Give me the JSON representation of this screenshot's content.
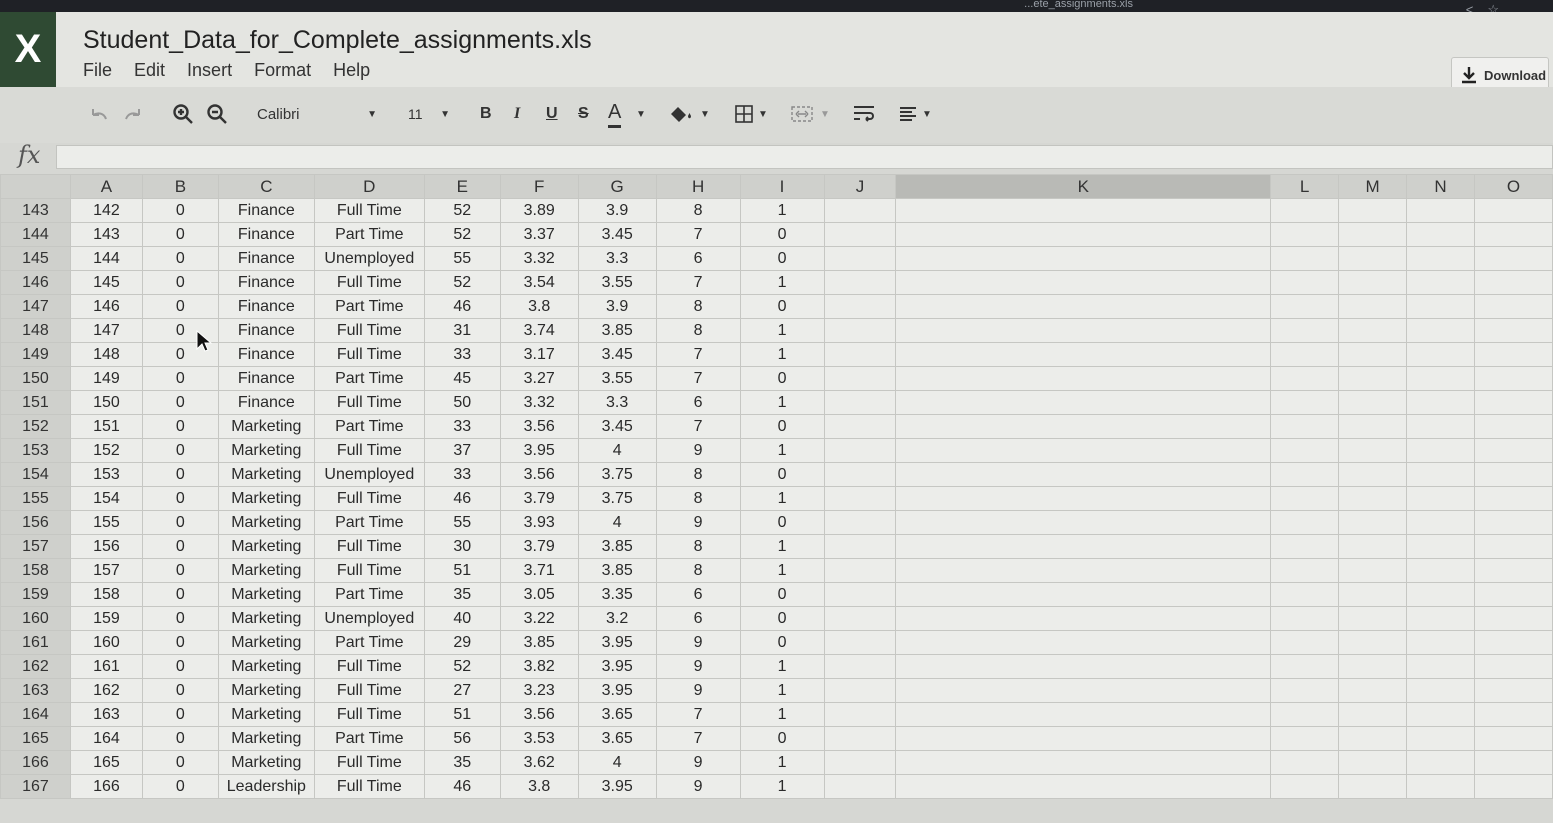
{
  "browser": {
    "url_text": "...ete_assignments.xls",
    "share_icon": "share-icon",
    "star_icon": "star-icon"
  },
  "app": {
    "logo": "X"
  },
  "document": {
    "title": "Student_Data_for_Complete_assignments.xls"
  },
  "menu": [
    "File",
    "Edit",
    "Insert",
    "Format",
    "Help"
  ],
  "download": {
    "label": "Download"
  },
  "toolbar": {
    "font": "Calibri",
    "font_size": "11",
    "bold": "B",
    "italic": "I",
    "underline": "U",
    "strike": "S",
    "text_color": "A"
  },
  "formula": {
    "label": "fx",
    "value": ""
  },
  "columns": [
    "A",
    "B",
    "C",
    "D",
    "E",
    "F",
    "G",
    "H",
    "I",
    "J",
    "K",
    "L",
    "M",
    "N",
    "O"
  ],
  "rows": [
    [
      "143",
      "142",
      "0",
      "Finance",
      "Full Time",
      "52",
      "3.89",
      "3.9",
      "8",
      "1"
    ],
    [
      "144",
      "143",
      "0",
      "Finance",
      "Part Time",
      "52",
      "3.37",
      "3.45",
      "7",
      "0"
    ],
    [
      "145",
      "144",
      "0",
      "Finance",
      "Unemployed",
      "55",
      "3.32",
      "3.3",
      "6",
      "0"
    ],
    [
      "146",
      "145",
      "0",
      "Finance",
      "Full Time",
      "52",
      "3.54",
      "3.55",
      "7",
      "1"
    ],
    [
      "147",
      "146",
      "0",
      "Finance",
      "Part Time",
      "46",
      "3.8",
      "3.9",
      "8",
      "0"
    ],
    [
      "148",
      "147",
      "0",
      "Finance",
      "Full Time",
      "31",
      "3.74",
      "3.85",
      "8",
      "1"
    ],
    [
      "149",
      "148",
      "0",
      "Finance",
      "Full Time",
      "33",
      "3.17",
      "3.45",
      "7",
      "1"
    ],
    [
      "150",
      "149",
      "0",
      "Finance",
      "Part Time",
      "45",
      "3.27",
      "3.55",
      "7",
      "0"
    ],
    [
      "151",
      "150",
      "0",
      "Finance",
      "Full Time",
      "50",
      "3.32",
      "3.3",
      "6",
      "1"
    ],
    [
      "152",
      "151",
      "0",
      "Marketing",
      "Part Time",
      "33",
      "3.56",
      "3.45",
      "7",
      "0"
    ],
    [
      "153",
      "152",
      "0",
      "Marketing",
      "Full Time",
      "37",
      "3.95",
      "4",
      "9",
      "1"
    ],
    [
      "154",
      "153",
      "0",
      "Marketing",
      "Unemployed",
      "33",
      "3.56",
      "3.75",
      "8",
      "0"
    ],
    [
      "155",
      "154",
      "0",
      "Marketing",
      "Full Time",
      "46",
      "3.79",
      "3.75",
      "8",
      "1"
    ],
    [
      "156",
      "155",
      "0",
      "Marketing",
      "Part Time",
      "55",
      "3.93",
      "4",
      "9",
      "0"
    ],
    [
      "157",
      "156",
      "0",
      "Marketing",
      "Full Time",
      "30",
      "3.79",
      "3.85",
      "8",
      "1"
    ],
    [
      "158",
      "157",
      "0",
      "Marketing",
      "Full Time",
      "51",
      "3.71",
      "3.85",
      "8",
      "1"
    ],
    [
      "159",
      "158",
      "0",
      "Marketing",
      "Part Time",
      "35",
      "3.05",
      "3.35",
      "6",
      "0"
    ],
    [
      "160",
      "159",
      "0",
      "Marketing",
      "Unemployed",
      "40",
      "3.22",
      "3.2",
      "6",
      "0"
    ],
    [
      "161",
      "160",
      "0",
      "Marketing",
      "Part Time",
      "29",
      "3.85",
      "3.95",
      "9",
      "0"
    ],
    [
      "162",
      "161",
      "0",
      "Marketing",
      "Full Time",
      "52",
      "3.82",
      "3.95",
      "9",
      "1"
    ],
    [
      "163",
      "162",
      "0",
      "Marketing",
      "Full Time",
      "27",
      "3.23",
      "3.95",
      "9",
      "1"
    ],
    [
      "164",
      "163",
      "0",
      "Marketing",
      "Full Time",
      "51",
      "3.56",
      "3.65",
      "7",
      "1"
    ],
    [
      "165",
      "164",
      "0",
      "Marketing",
      "Part Time",
      "56",
      "3.53",
      "3.65",
      "7",
      "0"
    ],
    [
      "166",
      "165",
      "0",
      "Marketing",
      "Full Time",
      "35",
      "3.62",
      "4",
      "9",
      "1"
    ],
    [
      "167",
      "166",
      "0",
      "Leadership",
      "Full Time",
      "46",
      "3.8",
      "3.95",
      "9",
      "1"
    ]
  ]
}
